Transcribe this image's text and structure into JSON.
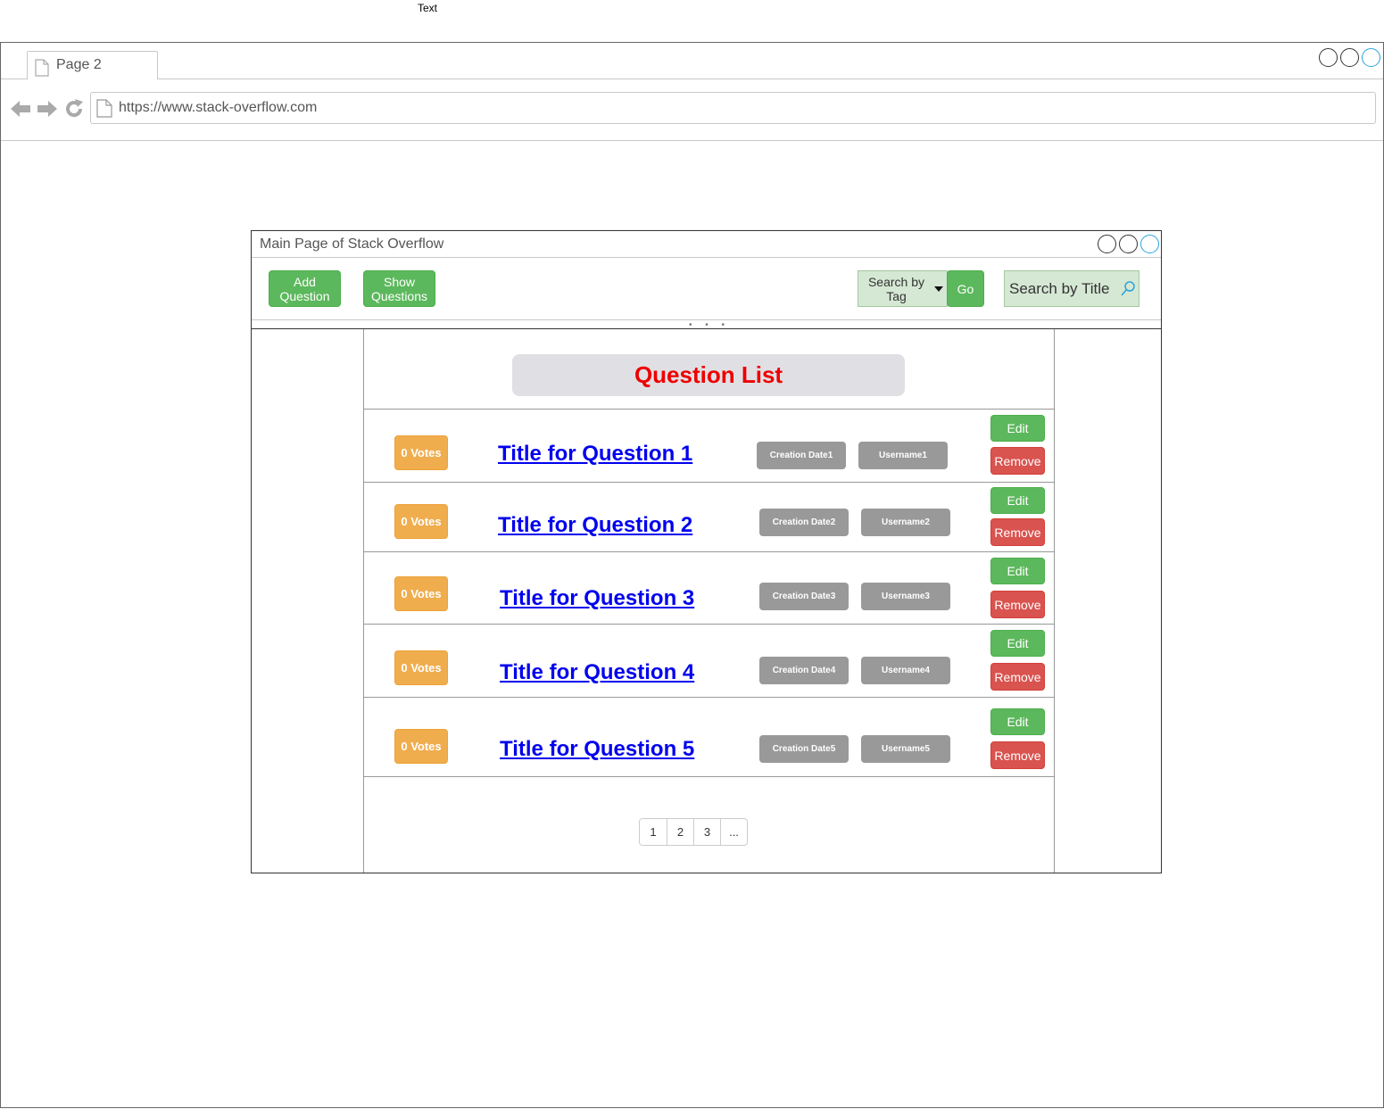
{
  "floating_label": "Text",
  "browser": {
    "tab_label": "Page 2",
    "url": "https://www.stack-overflow.com"
  },
  "app": {
    "title": "Main Page of Stack Overflow",
    "toolbar": {
      "add_question": "Add Question",
      "show_questions": "Show Questions",
      "search_by_tag": "Search by Tag",
      "go": "Go",
      "search_by_title": "Search by Title"
    },
    "heading": "Question List",
    "questions": [
      {
        "votes": "0 Votes",
        "title": "Title for Question 1",
        "date": "Creation Date1",
        "user": "Username1",
        "edit": "Edit",
        "remove": "Remove"
      },
      {
        "votes": "0 Votes",
        "title": "Title for Question 2",
        "date": "Creation Date2",
        "user": "Username2",
        "edit": "Edit",
        "remove": "Remove"
      },
      {
        "votes": "0 Votes",
        "title": "Title for Question 3",
        "date": "Creation Date3",
        "user": "Username3",
        "edit": "Edit",
        "remove": "Remove"
      },
      {
        "votes": "0 Votes",
        "title": "Title for Question 4",
        "date": "Creation Date4",
        "user": "Username4",
        "edit": "Edit",
        "remove": "Remove"
      },
      {
        "votes": "0 Votes",
        "title": "Title for Question 5",
        "date": "Creation Date5",
        "user": "Username5",
        "edit": "Edit",
        "remove": "Remove"
      }
    ],
    "pagination": [
      "1",
      "2",
      "3",
      "..."
    ]
  },
  "colors": {
    "primary_green": "#5cb85c",
    "danger_red": "#d9534f",
    "votes_orange": "#f0ad4e",
    "heading_red": "#ee0000",
    "link_blue": "#0000ee"
  }
}
